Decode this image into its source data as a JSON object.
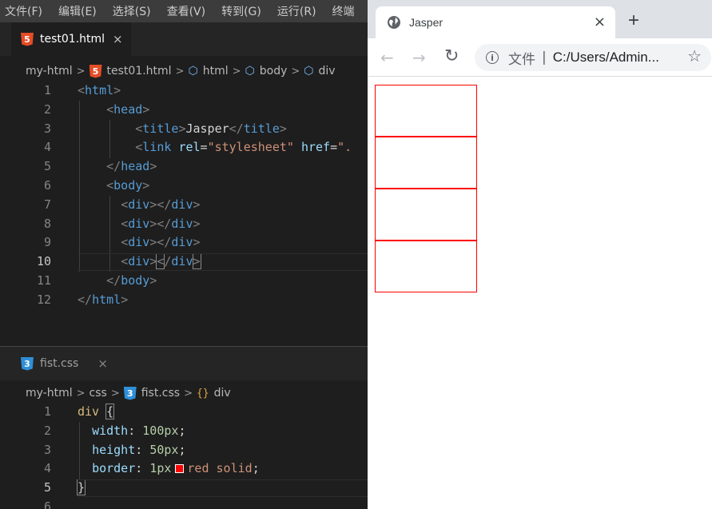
{
  "menu": [
    "文件(F)",
    "编辑(E)",
    "选择(S)",
    "查看(V)",
    "转到(G)",
    "运行(R)",
    "终端"
  ],
  "editor1": {
    "tab": {
      "name": "test01.html",
      "close": "×",
      "icon": "html5-icon",
      "badge": "5"
    },
    "breadcrumb": {
      "folder": "my-html",
      "file": "test01.html",
      "crumbs": [
        "html",
        "body",
        "div"
      ],
      "sep": ">"
    },
    "current_line": 10,
    "lines": [
      {
        "n": "1"
      },
      {
        "n": "2"
      },
      {
        "n": "3"
      },
      {
        "n": "4"
      },
      {
        "n": "5"
      },
      {
        "n": "6"
      },
      {
        "n": "7"
      },
      {
        "n": "8"
      },
      {
        "n": "9"
      },
      {
        "n": "10"
      },
      {
        "n": "11"
      },
      {
        "n": "12"
      }
    ]
  },
  "editor2": {
    "tab": {
      "name": "fist.css",
      "close": "×",
      "icon": "css3-icon",
      "badge": "3"
    },
    "breadcrumb": {
      "folder": "my-html",
      "dir": "css",
      "file": "fist.css",
      "symbol": "div",
      "sep": ">"
    },
    "lines": [
      {
        "n": "1"
      },
      {
        "n": "2"
      },
      {
        "n": "3"
      },
      {
        "n": "4"
      },
      {
        "n": "5"
      },
      {
        "n": "6"
      }
    ],
    "color_swatch": "#ff0000"
  },
  "browser": {
    "tab_title": "Jasper",
    "tab_close": "×",
    "new_tab": "+",
    "back": "←",
    "forward": "→",
    "reload": "↻",
    "info": "i",
    "chip": "文件",
    "pipe": "|",
    "url": "C:/Users/Admin...",
    "star": "☆",
    "box_count": 4,
    "box_border_color": "#ff0000"
  }
}
